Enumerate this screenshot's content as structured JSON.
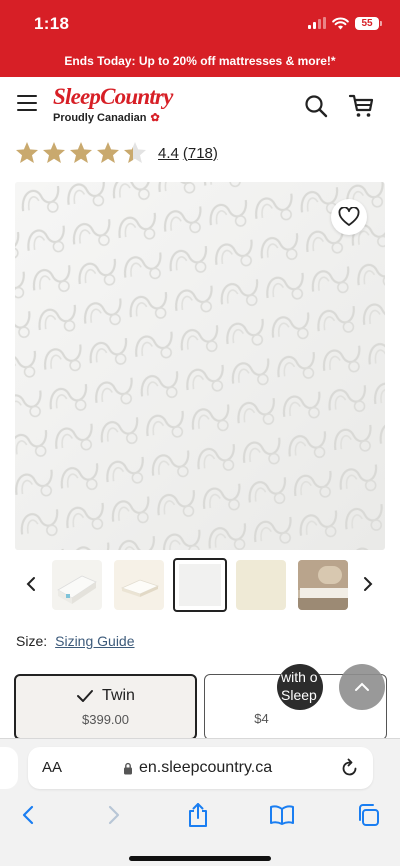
{
  "status_bar": {
    "time": "1:18",
    "battery": "55"
  },
  "promo": {
    "text": "Ends Today: Up to 20% off mattresses & more!*"
  },
  "header": {
    "logo": "SleepCountry",
    "tagline": "Proudly Canadian",
    "icons": [
      "menu-icon",
      "search-icon",
      "cart-icon"
    ]
  },
  "rating": {
    "stars": 4.4,
    "value": "4.4",
    "count": "(718)",
    "star_color": "#c9a96e"
  },
  "product": {
    "thumbnail_count": 5,
    "selected_thumbnail": 3
  },
  "size": {
    "label": "Size:",
    "guide": "Sizing Guide",
    "options": [
      {
        "name": "Twin",
        "price": "$399.00",
        "selected": true
      },
      {
        "name": "",
        "price": "$4",
        "selected": false
      }
    ]
  },
  "chat": {
    "text": "with o\nSleep"
  },
  "browser": {
    "aa": "AA",
    "url": "en.sleepcountry.ca"
  },
  "colors": {
    "brand_red": "#d71f26",
    "link_blue": "#3c5a7a",
    "ios_blue": "#1a7ef2"
  }
}
